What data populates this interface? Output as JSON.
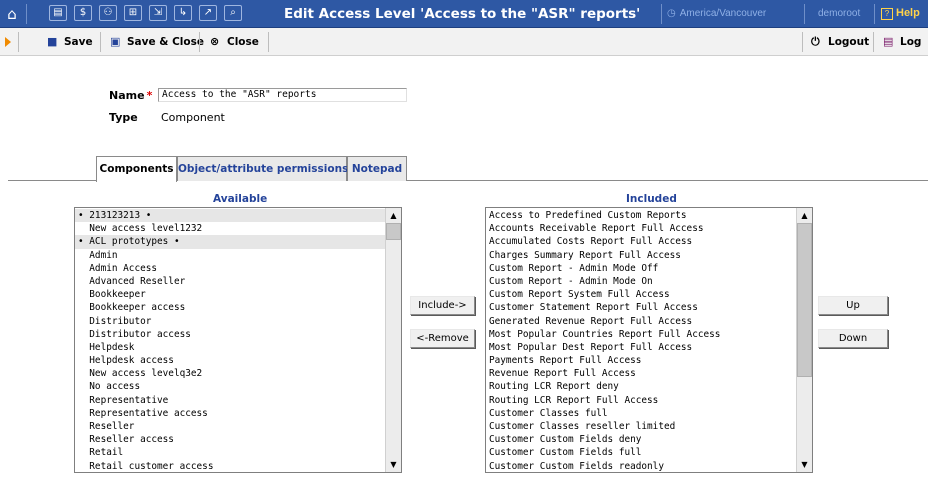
{
  "header": {
    "title": "Edit Access Level 'Access to the \"ASR\" reports'",
    "timezone": "America/Vancouver",
    "user": "demoroot",
    "help": "Help",
    "icons": [
      "home-icon",
      "grid-icon",
      "dollar-icon",
      "people-icon",
      "tree-icon",
      "flow-icon",
      "stack-icon",
      "chart-icon",
      "search-icon"
    ]
  },
  "toolbar": {
    "save": "Save",
    "save_close": "Save & Close",
    "close": "Close",
    "logout": "Logout",
    "log": "Log"
  },
  "form": {
    "name_label": "Name",
    "name_value": "Access to the \"ASR\" reports",
    "type_label": "Type",
    "type_value": "Component"
  },
  "tabs": [
    "Components",
    "Object/attribute permissions",
    "Notepad"
  ],
  "available": {
    "header": "Available",
    "items": [
      "• 213123213 •",
      "  New access level1232",
      "• ACL prototypes •",
      "  Admin",
      "  Admin Access",
      "  Advanced Reseller",
      "  Bookkeeper",
      "  Bookkeeper access",
      "  Distributor",
      "  Distributor access",
      "  Helpdesk",
      "  Helpdesk access",
      "  New access levelq3e2",
      "  No access",
      "  Representative",
      "  Representative access",
      "  Reseller",
      "  Reseller access",
      "  Retail",
      "  Retail customer access"
    ]
  },
  "included": {
    "header": "Included",
    "items": [
      "Access to Predefined Custom Reports",
      "Accounts Receivable Report Full Access",
      "Accumulated Costs Report Full Access",
      "Charges Summary Report Full Access",
      "Custom Report - Admin Mode Off",
      "Custom Report - Admin Mode On",
      "Custom Report System Full Access",
      "Customer Statement Report Full Access",
      "Generated Revenue Report Full Access",
      "Most Popular Countries Report Full Access",
      "Most Popular Dest Report Full Access",
      "Payments Report Full Access",
      "Revenue Report Full Access",
      "Routing LCR Report deny",
      "Routing LCR Report Full Access",
      "Customer Classes full",
      "Customer Classes reseller limited",
      "Customer Custom Fields deny",
      "Customer Custom Fields full",
      "Customer Custom Fields readonly"
    ]
  },
  "buttons": {
    "include": "Include->",
    "remove": "<-Remove",
    "up": "Up",
    "down": "Down"
  }
}
